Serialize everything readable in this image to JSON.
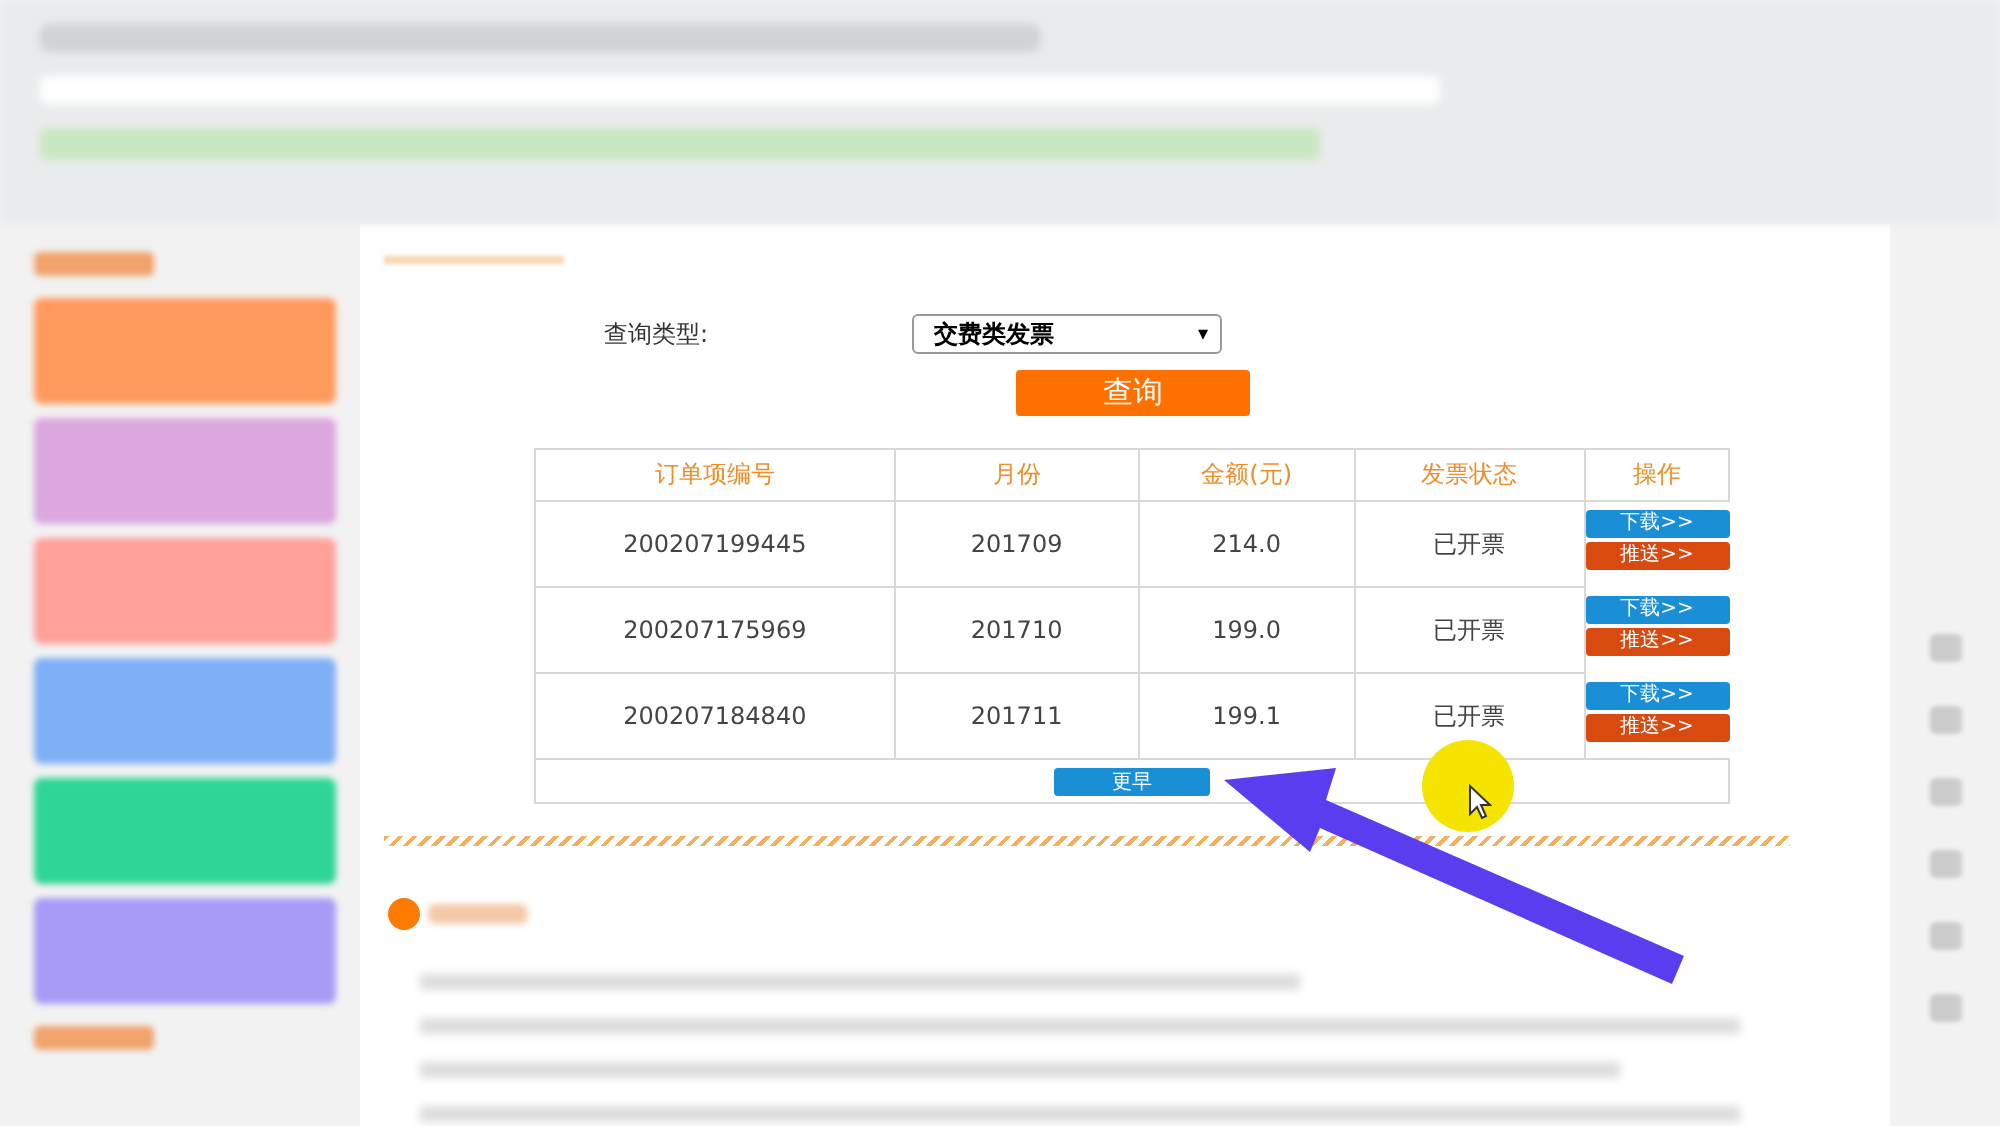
{
  "query": {
    "label": "查询类型:",
    "select_value": "交费类发票",
    "select_caret": "▾",
    "button": "查询"
  },
  "table": {
    "columns": [
      "订单项编号",
      "月份",
      "金额(元)",
      "发票状态",
      "操作"
    ],
    "rows": [
      {
        "cells": [
          "200207199445",
          "201709",
          "214.0",
          "已开票"
        ],
        "actions": [
          {
            "kind": "download",
            "label": "下载>>"
          },
          {
            "kind": "push",
            "label": "推送>>"
          }
        ]
      },
      {
        "cells": [
          "200207175969",
          "201710",
          "199.0",
          "已开票"
        ],
        "actions": [
          {
            "kind": "download",
            "label": "下载>>"
          },
          {
            "kind": "push",
            "label": "推送>>"
          }
        ]
      },
      {
        "cells": [
          "200207184840",
          "201711",
          "199.1",
          "已开票"
        ],
        "actions": [
          {
            "kind": "download",
            "label": "下载>>"
          },
          {
            "kind": "push",
            "label": "推送>>"
          }
        ]
      }
    ],
    "more_button": "更早"
  },
  "sidebar": {
    "cards": [
      {
        "color": "#ff9a5c"
      },
      {
        "color": "#dba7de"
      },
      {
        "color": "#ffa09a"
      },
      {
        "color": "#7fb0f5"
      },
      {
        "color": "#2ed596"
      },
      {
        "color": "#a79bf5"
      }
    ]
  }
}
